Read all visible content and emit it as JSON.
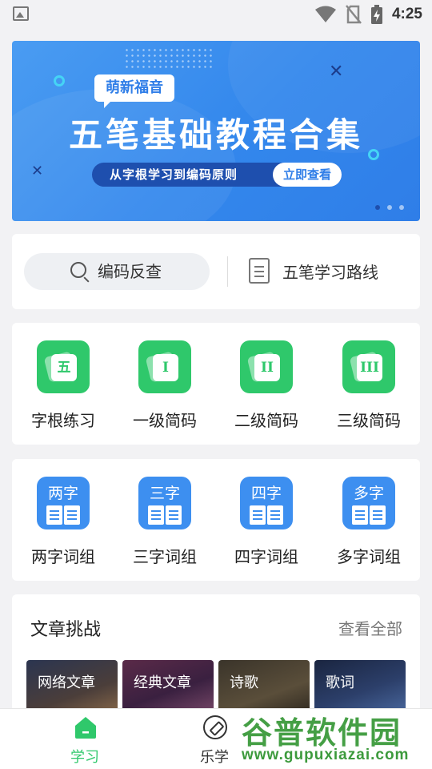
{
  "status_bar": {
    "time": "4:25"
  },
  "banner": {
    "tag": "萌新福音",
    "title": "五笔基础教程合集",
    "subtitle": "从字根学习到编码原则",
    "cta": "立即查看",
    "page_count": 3,
    "active_page": 1
  },
  "search_card": {
    "search_label": "编码反查",
    "route_label": "五笔学习路线"
  },
  "practice_grid": [
    {
      "glyph": "五",
      "label": "字根练习"
    },
    {
      "glyph": "I",
      "label": "一级简码"
    },
    {
      "glyph": "II",
      "label": "二级简码"
    },
    {
      "glyph": "III",
      "label": "三级简码"
    }
  ],
  "word_grid": [
    {
      "glyph": "两字",
      "label": "两字词组"
    },
    {
      "glyph": "三字",
      "label": "三字词组"
    },
    {
      "glyph": "四字",
      "label": "四字词组"
    },
    {
      "glyph": "多字",
      "label": "多字词组"
    }
  ],
  "articles": {
    "title": "文章挑战",
    "more": "查看全部",
    "tiles": [
      {
        "label": "网络文章"
      },
      {
        "label": "经典文章"
      },
      {
        "label": "诗歌"
      },
      {
        "label": "歌词"
      }
    ]
  },
  "bottom_nav": [
    {
      "label": "学习",
      "icon": "home-icon",
      "active": true
    },
    {
      "label": "乐学",
      "icon": "compass-icon",
      "active": false
    }
  ],
  "watermark": {
    "main": "谷普软件园",
    "url": "www.gupuxiazai.com"
  },
  "colors": {
    "green": "#2fc86b",
    "blue": "#3d8ff0",
    "banner": "#3387ec"
  }
}
